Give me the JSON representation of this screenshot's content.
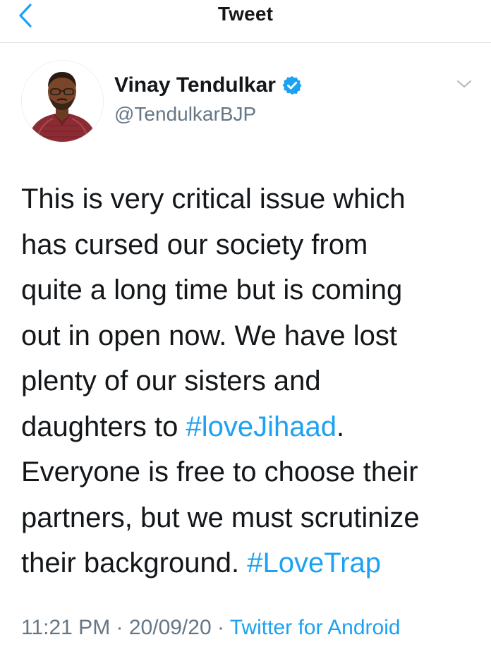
{
  "header": {
    "title": "Tweet",
    "back_icon": "chevron-left-icon",
    "accent_color": "#1da1f2"
  },
  "author": {
    "name": "Vinay Tendulkar",
    "handle": "@TendulkarBJP",
    "verified": true,
    "verified_icon": "verified-badge-icon"
  },
  "tweet": {
    "lines": [
      {
        "text": "This is very critical issue which"
      },
      {
        "text": "has cursed our society from"
      },
      {
        "text": "quite a long time but is coming"
      },
      {
        "text": "out in open now. We have lost"
      },
      {
        "text": "plenty of our sisters and"
      },
      {
        "before": "daughters to ",
        "hashtag": "#loveJihaad",
        "after": "."
      },
      {
        "text": "Everyone is free to choose their"
      },
      {
        "text": "partners, but we must scrutinize"
      },
      {
        "before": "their background. ",
        "hashtag": "#LoveTrap",
        "after": ""
      }
    ]
  },
  "meta": {
    "time": "11:21 PM",
    "separator": " · ",
    "date": "20/09/20",
    "source": "Twitter for Android"
  },
  "colors": {
    "text": "#14171a",
    "secondary": "#657786",
    "link": "#1da1f2",
    "divider": "#d8dde1"
  }
}
